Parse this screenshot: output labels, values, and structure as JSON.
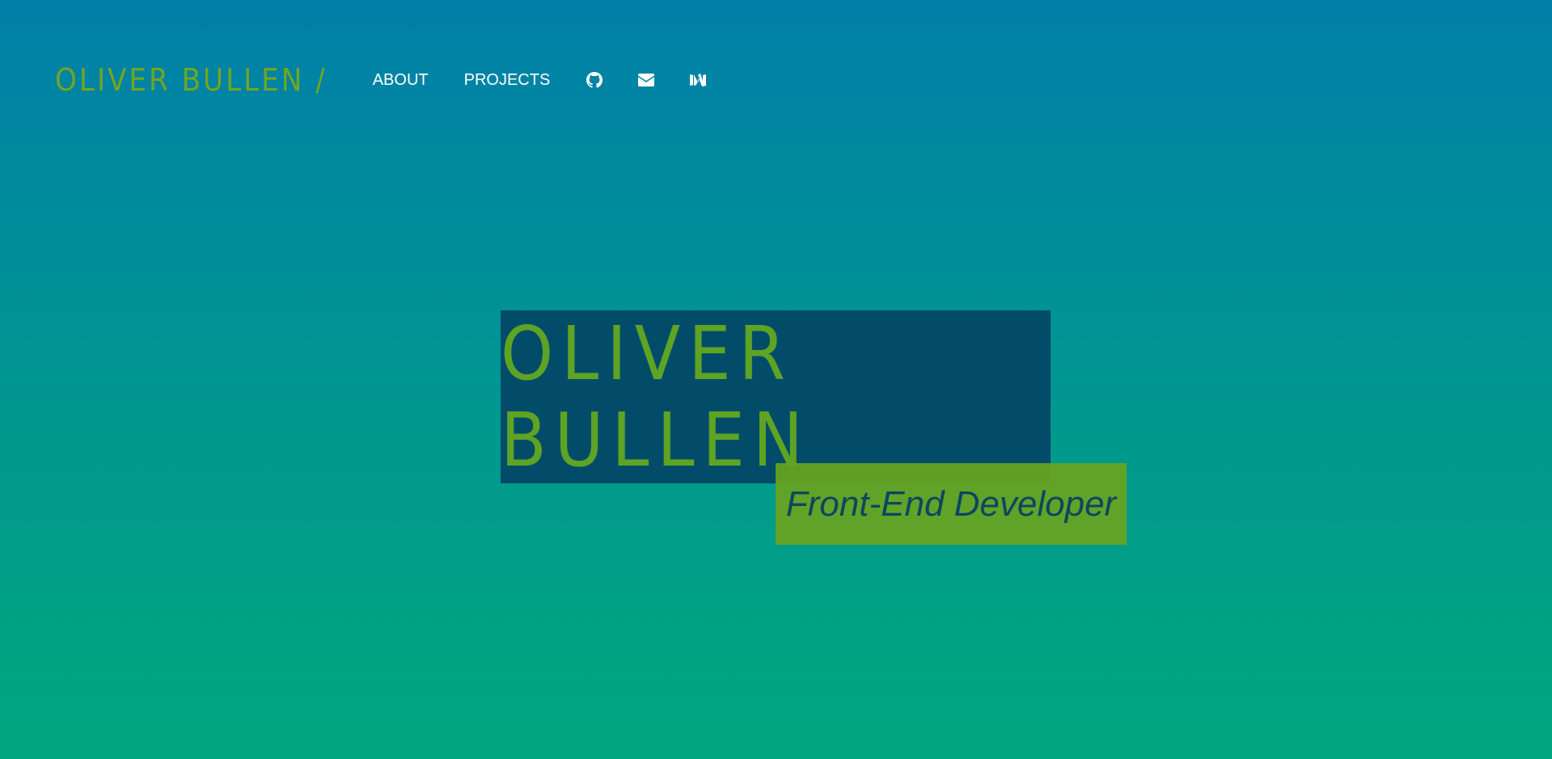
{
  "nav": {
    "brand": "OLIVER BULLEN /",
    "links": [
      {
        "label": "ABOUT"
      },
      {
        "label": "PROJECTS"
      }
    ],
    "icons": [
      {
        "name": "github-icon"
      },
      {
        "name": "envelope-icon"
      },
      {
        "name": "medium-icon"
      }
    ]
  },
  "hero": {
    "title": "OLIVER BULLEN",
    "subtitle": "Front-End Developer"
  },
  "colors": {
    "accent_green": "#5ea323",
    "title_box": "#034c69",
    "gradient_top": "#007fa8",
    "gradient_bottom": "#00a67e"
  }
}
